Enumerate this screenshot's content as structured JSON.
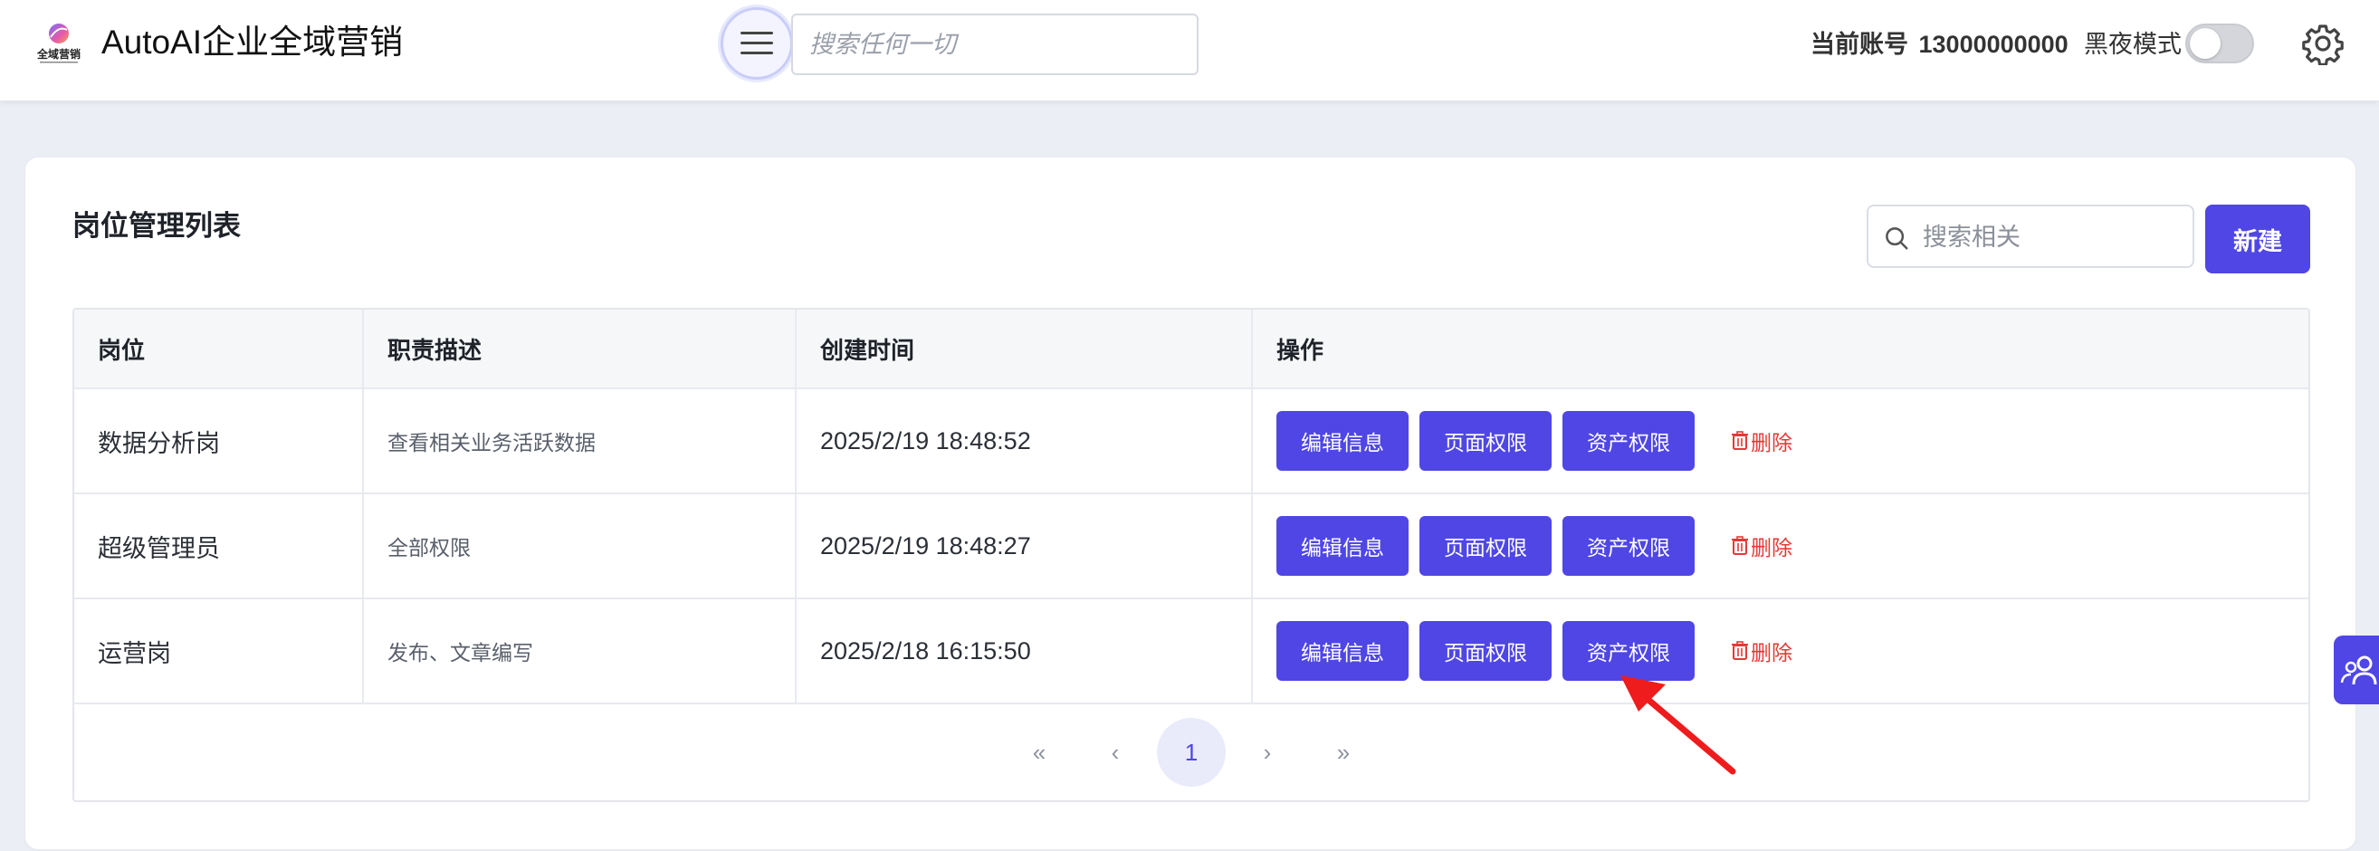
{
  "header": {
    "logo_text": "全域营销",
    "app_title": "AutoAI企业全域营销",
    "search_placeholder": "搜索任何一切",
    "account_label": "当前账号",
    "account_number": "13000000000",
    "dark_mode_label": "黑夜模式",
    "dark_mode_on": false,
    "icons": {
      "menu": "hamburger-icon",
      "settings": "gear-icon"
    }
  },
  "card": {
    "title": "岗位管理列表",
    "search_placeholder": "搜索相关",
    "new_button": "新建"
  },
  "table": {
    "columns": [
      "岗位",
      "职责描述",
      "创建时间",
      "操作"
    ],
    "rows": [
      {
        "name": "数据分析岗",
        "desc": "查看相关业务活跃数据",
        "time": "2025/2/19 18:48:52"
      },
      {
        "name": "超级管理员",
        "desc": "全部权限",
        "time": "2025/2/19 18:48:27"
      },
      {
        "name": "运营岗",
        "desc": "发布、文章编写",
        "time": "2025/2/18 16:15:50"
      }
    ],
    "actions": {
      "edit": "编辑信息",
      "page_perm": "页面权限",
      "asset_perm": "资产权限",
      "delete": "删除"
    }
  },
  "pagination": {
    "first": "«",
    "prev": "‹",
    "current": "1",
    "next": "›",
    "last": "»"
  },
  "colors": {
    "primary": "#4f46e5",
    "danger": "#e53935",
    "background": "#eceef6"
  }
}
